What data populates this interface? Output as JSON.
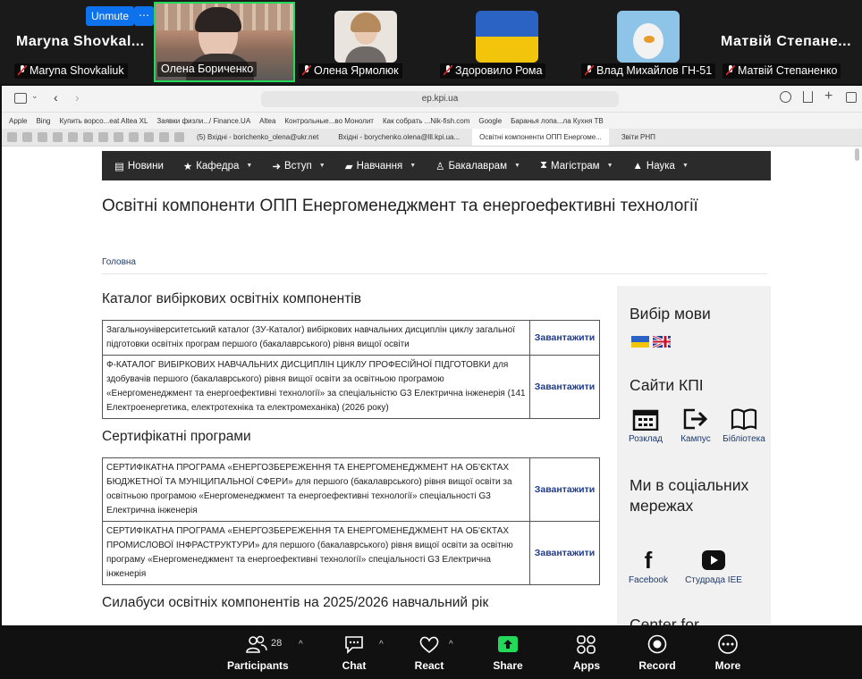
{
  "zoom": {
    "unmute_label": "Unmute",
    "more_dots": "⋯",
    "participants_top": [
      {
        "big_name": "Maryna  Shovkal...",
        "label": "Maryna Shovkaliuk"
      },
      {
        "big_name": "",
        "label": "Олена Бориченко"
      },
      {
        "big_name": "",
        "label": "Олена Ярмолюк"
      },
      {
        "big_name": "",
        "label": "Здоровило Рома"
      },
      {
        "big_name": "",
        "label": "Влад Михайлов ГН-51"
      },
      {
        "big_name": "Матвій  Степане...",
        "label": "Матвій Степаненко"
      }
    ],
    "toolbar": {
      "participants_label": "Participants",
      "participants_count": "28",
      "chat_label": "Chat",
      "react_label": "React",
      "share_label": "Share",
      "apps_label": "Apps",
      "record_label": "Record",
      "more_label": "More"
    },
    "colors": {
      "share_green": "#23d959",
      "unmute_blue": "#0e72ed",
      "active_speaker": "#23d959"
    }
  },
  "browser": {
    "url": "ep.kpi.ua",
    "bookmarks": [
      "Apple",
      "Bing",
      "Купить ворсо...eat Altea XL",
      "Заявки физли.../ Finance.UA",
      "Altea",
      "Контрольные...во Монолит",
      "Как собрать ...Nik-fish.com",
      "Google",
      "Баранья лопа...ла Кухня ТВ"
    ],
    "tabs": [
      "(5) Вхідні - borichenko_olena@ukr.net",
      "Вхідні - borychenko.olena@lll.kpi.ua...",
      "Освітні компоненти ОПП Енергоме...",
      "Звіти РНП"
    ]
  },
  "page": {
    "nav": [
      "Новини",
      "Кафедра",
      "Вступ",
      "Навчання",
      "Бакалаврам",
      "Магістрам",
      "Наука"
    ],
    "title": "Освітні компоненти ОПП Енергоменеджмент та енергоефективні технології",
    "breadcrumb": "Головна",
    "section1_title": "Каталог вибіркових освітніх компонентів",
    "catalog_rows": [
      {
        "text": "Загальноуніверситетський каталог (ЗУ-Каталог) вибіркових навчальних дисциплін циклу загальної підготовки освітніх програм першого (бакалаврського) рівня вищої освіти",
        "link": "Завантажити"
      },
      {
        "text": "Ф-КАТАЛОГ ВИБІРКОВИХ НАВЧАЛЬНИХ ДИСЦИПЛІН ЦИКЛУ ПРОФЕСІЙНОЇ ПІДГОТОВКИ для здобувачів першого (бакалаврського) рівня вищої освіти за освітньою програмою «Енергоменеджмент та енергоефективні технології» за спеціальністю G3 Електрична інженерія (141 Електроенергетика, електротехніка та електромеханіка) (2026 року)",
        "link": "Завантажити"
      }
    ],
    "section2_title": "Сертифікатні програми",
    "cert_rows": [
      {
        "text": "СЕРТИФІКАТНА ПРОГРАМА «ЕНЕРГОЗБЕРЕЖЕННЯ ТА ЕНЕРГОМЕНЕДЖМЕНТ НА ОБ'ЄКТАХ БЮДЖЕТНОЇ ТА МУНІЦИПАЛЬНОЇ СФЕРИ» для першого (бакалаврського) рівня вищої освіти за освітньою програмою «Енергоменеджмент та енергоефективні технології» спеціальності G3 Електрична інженерія",
        "link": "Завантажити"
      },
      {
        "text": "СЕРТИФІКАТНА ПРОГРАМА «ЕНЕРГОЗБЕРЕЖЕННЯ ТА ЕНЕРГОМЕНЕДЖМЕНТ НА ОБ'ЄКТАХ ПРОМИСЛОВОЇ ІНФРАСТРУКТУРИ» для першого (бакалаврського) рівня вищої освіти за освітню програму «Енергоменеджмент та енергоефективні технології» спеціальності G3 Електрична інженерія",
        "link": "Завантажити"
      }
    ],
    "section3_title": "Силабуси освітніх компонентів на 2025/2026 навчальний рік",
    "sidebar": {
      "lang_title": "Вибір мови",
      "sites_title": "Сайти КПІ",
      "sites": [
        "Розклад",
        "Кампус",
        "Бібліотека"
      ],
      "social_title": "Ми в соціальних мережах",
      "social": [
        "Facebook",
        "Студрада IEE"
      ],
      "next_title": "Center for"
    }
  }
}
